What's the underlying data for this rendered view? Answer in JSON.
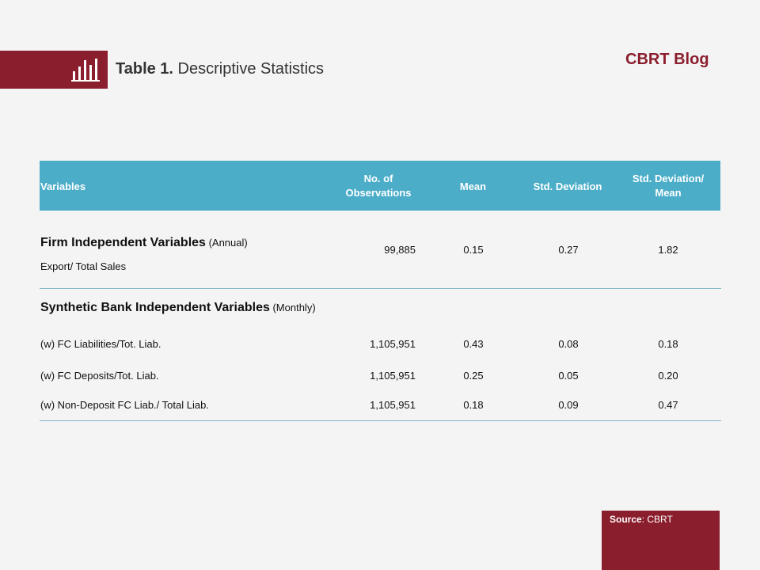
{
  "header": {
    "title_bold": "Table 1.",
    "title_rest": " Descriptive Statistics",
    "blog_label": "CBRT Blog",
    "accent_color": "#8b1e2d",
    "icon": "bar-chart-icon"
  },
  "table": {
    "header_color": "#4badc8",
    "columns": [
      "Variables",
      "No. of Observations",
      "Mean",
      "Std. Deviation",
      "Std. Deviation/ Mean"
    ],
    "col1_line1": "No. of",
    "col1_line2": "Observations",
    "col4_line1": "Std. Deviation/",
    "col4_line2": "Mean",
    "section1": {
      "title": "Firm Independent Variables",
      "qualifier": " (Annual)",
      "row": {
        "label": "Export/ Total Sales",
        "obs": "99,885",
        "mean": "0.15",
        "std": "0.27",
        "ratio": "1.82"
      }
    },
    "section2": {
      "title": "Synthetic Bank Independent Variables",
      "qualifier": " (Monthly)",
      "rows": [
        {
          "label": "(w) FC Liabilities/Tot. Liab.",
          "obs": "1,105,951",
          "mean": "0.43",
          "std": "0.08",
          "ratio": "0.18"
        },
        {
          "label": "(w) FC Deposits/Tot. Liab.",
          "obs": "1,105,951",
          "mean": "0.25",
          "std": "0.05",
          "ratio": "0.20"
        },
        {
          "label": "(w) Non-Deposit FC Liab./ Total Liab.",
          "obs": "1,105,951",
          "mean": "0.18",
          "std": "0.09",
          "ratio": "0.47"
        }
      ]
    }
  },
  "footer": {
    "source_label": "Source",
    "source_value": ": CBRT"
  }
}
